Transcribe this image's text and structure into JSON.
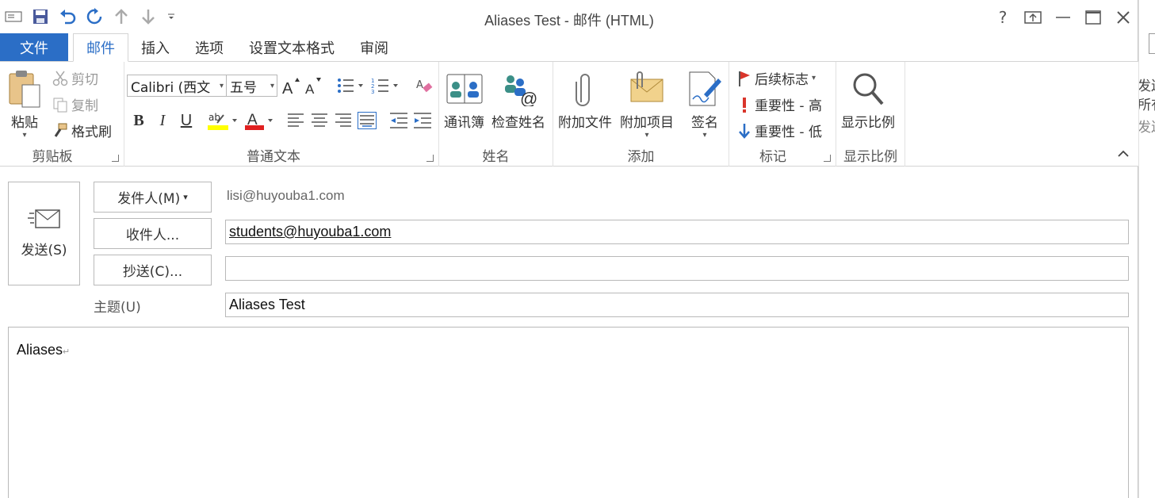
{
  "window": {
    "title": "Aliases Test - 邮件 (HTML)",
    "help": "?",
    "controls": {
      "ribbon_options": "⇱",
      "minimize": "—",
      "maximize": "☐",
      "close": "✕"
    }
  },
  "qat": {
    "items": [
      "send-receive-icon",
      "save-icon",
      "undo-icon",
      "redo-icon",
      "previous-item-icon",
      "next-item-icon",
      "customize-qat-icon"
    ]
  },
  "tabs": {
    "file": "文件",
    "items": [
      {
        "label": "邮件",
        "active": true
      },
      {
        "label": "插入",
        "active": false
      },
      {
        "label": "选项",
        "active": false
      },
      {
        "label": "设置文本格式",
        "active": false
      },
      {
        "label": "审阅",
        "active": false
      }
    ]
  },
  "ribbon": {
    "clipboard": {
      "paste": "粘贴",
      "cut": "剪切",
      "copy": "复制",
      "format_painter": "格式刷",
      "label": "剪贴板"
    },
    "basic_text": {
      "font": "Calibri (西文",
      "size": "五号",
      "label": "普通文本",
      "bold": "B",
      "italic": "I",
      "underline": "U",
      "highlight_text": "ab",
      "font_color_text": "A"
    },
    "names": {
      "address_book": "通讯簿",
      "check_names": "检查姓名",
      "label": "姓名"
    },
    "include": {
      "attach_file": "附加文件",
      "attach_item": "附加项目",
      "signature": "签名",
      "label": "添加"
    },
    "tags": {
      "follow_up": "后续标志",
      "high_importance": "重要性 - 高",
      "low_importance": "重要性 - 低",
      "label": "标记"
    },
    "zoom": {
      "zoom": "显示比例",
      "label": "显示比例"
    }
  },
  "message": {
    "send": "发送(S)",
    "from_button": "发件人(M)",
    "from_value": "lisi@huyouba1.com",
    "to_button": "收件人...",
    "to_value": "students@huyouba1.com",
    "cc_button": "抄送(C)...",
    "cc_value": "",
    "subject_label": "主题(U)",
    "subject_value": "Aliases Test",
    "body": "Aliases",
    "paragraph_mark": "↵"
  },
  "side_peek": {
    "line1": "发送",
    "line2": "所有",
    "line3": "发送"
  },
  "colors": {
    "accent": "#2b6ec6",
    "highlight": "#ffff00",
    "font_color": "#e02020",
    "flag": "#d9352b",
    "importance_high": "#d9352b",
    "importance_low": "#2b6ec6"
  }
}
